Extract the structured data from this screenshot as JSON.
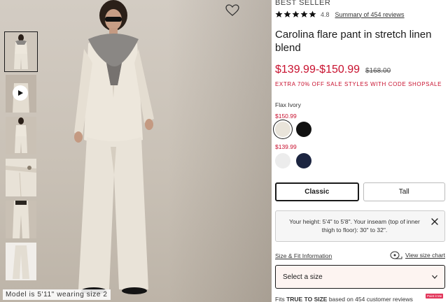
{
  "colors": {
    "sale_red": "#c8102e",
    "swatch_flax_ivory": "#e9e4da",
    "swatch_black": "#111111",
    "swatch_white": "#ececec",
    "swatch_navy": "#1c2540"
  },
  "gallery": {
    "wishlist_icon": "heart-outline-icon",
    "video_thumb_icon": "play-icon",
    "model_caption": "Model is 5'11\" wearing size 2"
  },
  "product": {
    "eyebrow": "BEST SELLER",
    "rating_value": "4.8",
    "rating_stars": 5,
    "reviews_link": "Summary of 454 reviews",
    "title": "Carolina flare pant in stretch linen blend",
    "price_range": "$139.99-$150.99",
    "original_price": "$168.00",
    "promo": "EXTRA 70% OFF SALE STYLES WITH CODE SHOPSALE"
  },
  "color": {
    "selected_name": "Flax Ivory",
    "group1_price": "$150.99",
    "group2_price": "$139.99"
  },
  "fit": {
    "options": [
      "Classic",
      "Tall"
    ],
    "selected": "Classic"
  },
  "height_note": {
    "text": "Your height: 5'4\" to 5'8\". Your inseam (top of inner thigh to floor): 30\" to 32\".",
    "close_icon": "close-icon"
  },
  "size": {
    "info_link": "Size & Fit Information",
    "chart_link": "View size chart",
    "chart_icon": "measuring-tape-icon",
    "select_placeholder": "Select a size",
    "select_icon": "chevron-down-icon"
  },
  "fit_summary": {
    "prefix": "Fits ",
    "bold": "TRUE TO SIZE",
    "suffix": " based on 454 customer reviews"
  },
  "chip": "Paint it Me"
}
